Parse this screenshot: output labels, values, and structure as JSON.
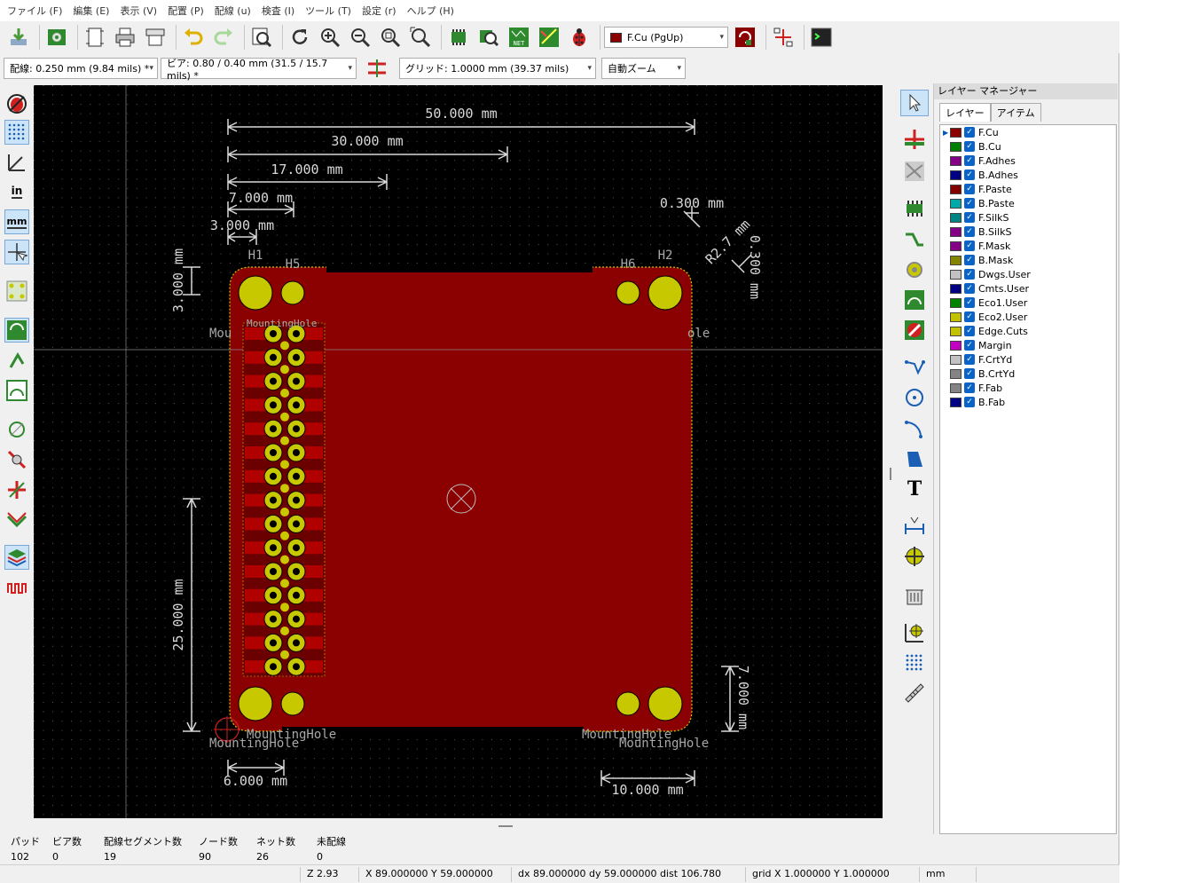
{
  "menu": [
    "ファイル (F)",
    "編集 (E)",
    "表示 (V)",
    "配置 (P)",
    "配線 (u)",
    "検査 (I)",
    "ツール (T)",
    "設定 (r)",
    "ヘルプ (H)"
  ],
  "toolbar": {
    "active_layer": "F.Cu (PgUp)",
    "track_width": "配線: 0.250 mm (9.84 mils) *",
    "via_size": "ビア: 0.80 / 0.40 mm (31.5 / 15.7 mils) *",
    "grid": "グリッド: 1.0000 mm (39.37 mils)",
    "zoom": "自動ズーム",
    "net_label": "NET"
  },
  "left_toolbar": {
    "inch_label": "in",
    "mm_label": "mm"
  },
  "right_toolbar": {
    "text_tool_label": "T"
  },
  "board": {
    "dimensions": {
      "d50": "50.000 mm",
      "d30": "30.000 mm",
      "d17": "17.000 mm",
      "d7": "7.000 mm",
      "d3": "3.000 mm",
      "d03h": "0.300 mm",
      "dr27": "R2.7 mm",
      "d03v": "0.300 mm",
      "dv3": "3.000 mm",
      "dv25": "25.000 mm",
      "dv7": "7.000 mm",
      "d6": "6.000 mm",
      "d10": "10.000 mm"
    },
    "refs": {
      "h1": "H1",
      "h5": "H5",
      "h6": "H6",
      "h2": "H2",
      "mh_bl1": "MountingHole",
      "mh_bl2": "MountingHole",
      "mh_br1": "MountingHole",
      "mh_br2": "MountingHole",
      "mh_left_partial": "Mou",
      "mh_right_partial": "ole",
      "connector_label": "MountingHole"
    }
  },
  "layer_manager": {
    "title": "レイヤー マネージャー",
    "tabs": [
      "レイヤー",
      "アイテム"
    ],
    "layers": [
      {
        "name": "F.Cu",
        "color": "#8b0000",
        "checked": true
      },
      {
        "name": "B.Cu",
        "color": "#008000",
        "checked": true
      },
      {
        "name": "F.Adhes",
        "color": "#840084",
        "checked": true
      },
      {
        "name": "B.Adhes",
        "color": "#000084",
        "checked": true
      },
      {
        "name": "F.Paste",
        "color": "#840000",
        "checked": true
      },
      {
        "name": "B.Paste",
        "color": "#00a8a8",
        "checked": true
      },
      {
        "name": "F.SilkS",
        "color": "#008484",
        "checked": true
      },
      {
        "name": "B.SilkS",
        "color": "#840084",
        "checked": true
      },
      {
        "name": "F.Mask",
        "color": "#840084",
        "checked": true
      },
      {
        "name": "B.Mask",
        "color": "#848400",
        "checked": true
      },
      {
        "name": "Dwgs.User",
        "color": "#c2c2c2",
        "checked": true
      },
      {
        "name": "Cmts.User",
        "color": "#000084",
        "checked": true
      },
      {
        "name": "Eco1.User",
        "color": "#008400",
        "checked": true
      },
      {
        "name": "Eco2.User",
        "color": "#c2c200",
        "checked": true
      },
      {
        "name": "Edge.Cuts",
        "color": "#c2c200",
        "checked": true
      },
      {
        "name": "Margin",
        "color": "#c200c2",
        "checked": true
      },
      {
        "name": "F.CrtYd",
        "color": "#c2c2c2",
        "checked": true
      },
      {
        "name": "B.CrtYd",
        "color": "#848484",
        "checked": true
      },
      {
        "name": "F.Fab",
        "color": "#848484",
        "checked": true
      },
      {
        "name": "B.Fab",
        "color": "#000084",
        "checked": true
      }
    ]
  },
  "messages": {
    "pads_label": "パッド",
    "pads": "102",
    "vias_label": "ビア数",
    "vias": "0",
    "segments_label": "配線セグメント数",
    "segments": "19",
    "nodes_label": "ノード数",
    "nodes": "90",
    "nets_label": "ネット数",
    "nets": "26",
    "unrouted_label": "未配線",
    "unrouted": "0"
  },
  "status": {
    "zoom": "Z 2.93",
    "xy": "X 89.000000  Y 59.000000",
    "delta": "dx 89.000000  dy 59.000000  dist 106.780",
    "grid": "grid X 1.000000  Y 1.000000",
    "units": "mm"
  },
  "colors": {
    "board_fill": "#8b0000",
    "pad_yellow": "#c8c800",
    "dimension": "#d8d8d8",
    "edge_cuts": "#c8c800"
  }
}
